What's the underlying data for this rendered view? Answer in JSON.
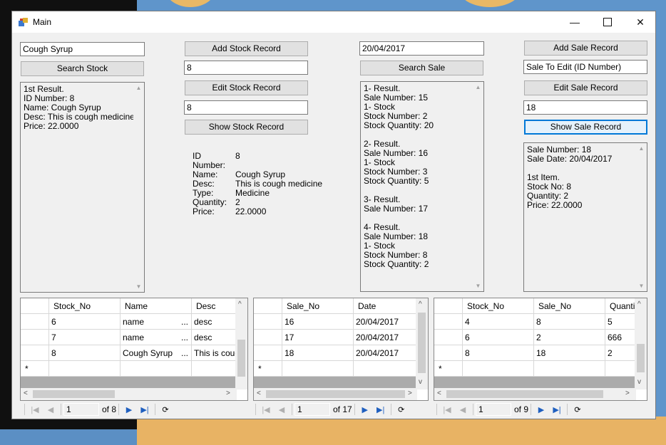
{
  "window": {
    "title": "Main"
  },
  "stock": {
    "search_value": "Cough Syrup",
    "search_button": "Search Stock",
    "results": [
      "1st Result.",
      "ID Number: 8",
      "Name: Cough Syrup",
      "Desc: This is cough medicine",
      "Price: 22.0000"
    ],
    "add_button": "Add Stock Record",
    "edit_id_value": "8",
    "edit_button": "Edit Stock Record",
    "show_id_value": "8",
    "show_button": "Show Stock Record",
    "details": {
      "id_label": "ID Number:",
      "id": "8",
      "name_label": "Name:",
      "name": "Cough Syrup",
      "desc_label": "Desc:",
      "desc": "This is cough medicine",
      "type_label": "Type:",
      "type": "Medicine",
      "quantity_label": "Quantity:",
      "quantity": "2",
      "price_label": "Price:",
      "price": "22.0000"
    }
  },
  "sale": {
    "search_value": "20/04/2017",
    "search_button": "Search Sale",
    "results": [
      "1- Result.",
      "Sale Number: 15",
      "1- Stock",
      "Stock Number: 2",
      "Stock Quantity: 20",
      "",
      "2- Result.",
      "Sale Number: 16",
      "1- Stock",
      "Stock Number: 3",
      "Stock Quantity: 5",
      "",
      "3- Result.",
      "Sale Number: 17",
      "",
      "4- Result.",
      "Sale Number: 18",
      "1- Stock",
      "Stock Number: 8",
      "Stock Quantity: 2"
    ],
    "add_button": "Add Sale Record",
    "edit_placeholder_value": "Sale To Edit (ID Number)",
    "edit_button": "Edit Sale Record",
    "show_id_value": "18",
    "show_button": "Show Sale Record",
    "details": [
      "Sale Number: 18",
      "Sale Date: 20/04/2017",
      "",
      "1st Item.",
      "Stock No: 8",
      "Quantity: 2",
      "Price: 22.0000"
    ]
  },
  "grids": {
    "stock": {
      "headers": [
        "Stock_No",
        "Name",
        "Desc"
      ],
      "rows": [
        [
          "6",
          "name",
          "desc"
        ],
        [
          "7",
          "name",
          "desc"
        ],
        [
          "8",
          "Cough Syrup",
          "This is coug"
        ]
      ],
      "new_row_marker": "*",
      "ellipsis": "...",
      "nav": {
        "position": "1",
        "count": "of 8"
      }
    },
    "sale": {
      "headers": [
        "Sale_No",
        "Date"
      ],
      "rows": [
        [
          "16",
          "20/04/2017"
        ],
        [
          "17",
          "20/04/2017"
        ],
        [
          "18",
          "20/04/2017"
        ]
      ],
      "new_row_marker": "*",
      "nav": {
        "position": "1",
        "count": "of 17"
      }
    },
    "items": {
      "headers": [
        "Stock_No",
        "Sale_No",
        "Quantit"
      ],
      "rows": [
        [
          "4",
          "8",
          "5"
        ],
        [
          "6",
          "2",
          "666"
        ],
        [
          "8",
          "18",
          "2"
        ]
      ],
      "new_row_marker": "*",
      "nav": {
        "position": "1",
        "count": "of 9"
      }
    }
  }
}
